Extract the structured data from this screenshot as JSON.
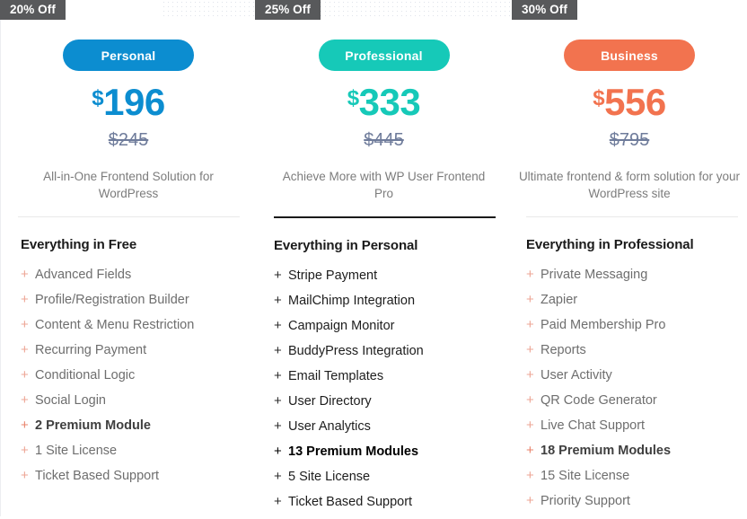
{
  "plans": [
    {
      "badge": "20% Off",
      "name": "Personal",
      "accent": "#0c8dd0",
      "currency": "$",
      "price": "196",
      "old_price": "$245",
      "subtitle": "All-in-One Frontend Solution for WordPress",
      "features_heading": "Everything in Free",
      "features": [
        {
          "label": "Advanced Fields",
          "bold": false
        },
        {
          "label": "Profile/Registration Builder",
          "bold": false
        },
        {
          "label": "Content & Menu Restriction",
          "bold": false
        },
        {
          "label": "Recurring Payment",
          "bold": false
        },
        {
          "label": "Conditional Logic",
          "bold": false
        },
        {
          "label": "Social Login",
          "bold": false
        },
        {
          "label": "2 Premium Module",
          "bold": true
        },
        {
          "label": "1 Site License",
          "bold": false
        },
        {
          "label": "Ticket Based Support",
          "bold": false
        }
      ]
    },
    {
      "badge": "25% Off",
      "name": "Professional",
      "accent": "#16c9b8",
      "currency": "$",
      "price": "333",
      "old_price": "$445",
      "subtitle": "Achieve More with WP User Frontend Pro",
      "features_heading": "Everything in Personal",
      "features": [
        {
          "label": "Stripe Payment",
          "bold": false
        },
        {
          "label": "MailChimp Integration",
          "bold": false
        },
        {
          "label": "Campaign Monitor",
          "bold": false
        },
        {
          "label": "BuddyPress Integration",
          "bold": false
        },
        {
          "label": "Email Templates",
          "bold": false
        },
        {
          "label": "User Directory",
          "bold": false
        },
        {
          "label": "User Analytics",
          "bold": false
        },
        {
          "label": "13 Premium Modules",
          "bold": true
        },
        {
          "label": "5 Site License",
          "bold": false
        },
        {
          "label": "Ticket Based Support",
          "bold": false
        }
      ]
    },
    {
      "badge": "30% Off",
      "name": "Business",
      "accent": "#f2734f",
      "currency": "$",
      "price": "556",
      "old_price": "$795",
      "subtitle": "Ultimate frontend & form solution for your WordPress site",
      "features_heading": "Everything in Professional",
      "features": [
        {
          "label": "Private Messaging",
          "bold": false
        },
        {
          "label": "Zapier",
          "bold": false
        },
        {
          "label": "Paid Membership Pro",
          "bold": false
        },
        {
          "label": "Reports",
          "bold": false
        },
        {
          "label": "User Activity",
          "bold": false
        },
        {
          "label": "QR Code Generator",
          "bold": false
        },
        {
          "label": "Live Chat Support",
          "bold": false
        },
        {
          "label": "18 Premium Modules",
          "bold": true
        },
        {
          "label": "15 Site License",
          "bold": false
        },
        {
          "label": "Priority Support",
          "bold": false
        }
      ]
    }
  ]
}
